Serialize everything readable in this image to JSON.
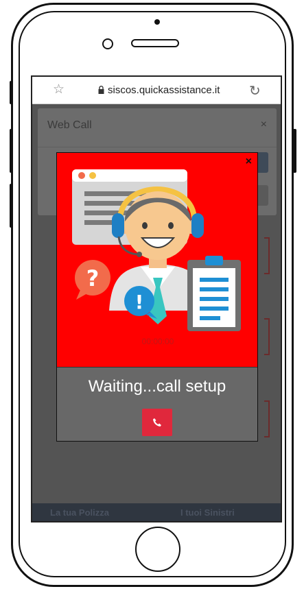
{
  "browser": {
    "url": "siscos.quickassistance.it"
  },
  "background_dialog": {
    "title": "Web Call",
    "close_label": "×"
  },
  "bottom_nav": {
    "items": [
      {
        "label": "La tua Polizza"
      },
      {
        "label": "I tuoi Sinistri"
      }
    ]
  },
  "call_modal": {
    "close_label": "×",
    "timer": "00:00:00",
    "status": "Waiting...call setup",
    "hangup_icon": "phone-hangup-icon"
  },
  "colors": {
    "modal_bg": "#ff0000",
    "status_panel": "#686868",
    "hangup": "#e0283c",
    "overlay": "#545454"
  }
}
